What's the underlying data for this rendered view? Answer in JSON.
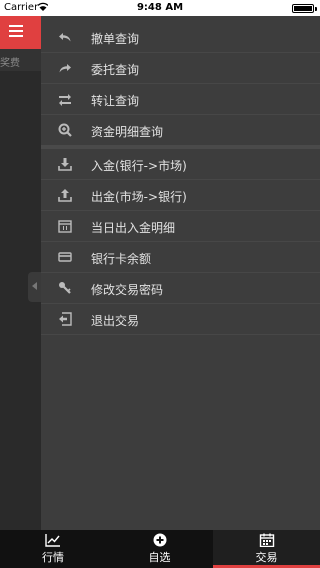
{
  "status_bar": {
    "carrier": "Carrier",
    "time": "9:48 AM"
  },
  "main": {
    "partial_text": "奖费"
  },
  "drawer": {
    "items": [
      {
        "label": "撤单查询",
        "icon": "undo-icon"
      },
      {
        "label": "委托查询",
        "icon": "redo-icon"
      },
      {
        "label": "转让查询",
        "icon": "transfer-icon"
      },
      {
        "label": "资金明细查询",
        "icon": "magnifier-icon"
      },
      {
        "label": "入金(银行->市场)",
        "icon": "download-icon"
      },
      {
        "label": "出金(市场->银行)",
        "icon": "upload-icon"
      },
      {
        "label": "当日出入金明细",
        "icon": "calendar-icon"
      },
      {
        "label": "银行卡余额",
        "icon": "card-icon"
      },
      {
        "label": "修改交易密码",
        "icon": "key-icon"
      },
      {
        "label": "退出交易",
        "icon": "exit-icon"
      }
    ]
  },
  "tab_bar": {
    "tabs": [
      {
        "label": "行情",
        "icon": "chart-icon"
      },
      {
        "label": "自选",
        "icon": "add-circle-icon"
      },
      {
        "label": "交易",
        "icon": "calendar-icon",
        "active": true
      }
    ]
  },
  "colors": {
    "accent": "#e04040",
    "drawer_bg": "#3d3d3d",
    "tab_bg": "#111111"
  }
}
